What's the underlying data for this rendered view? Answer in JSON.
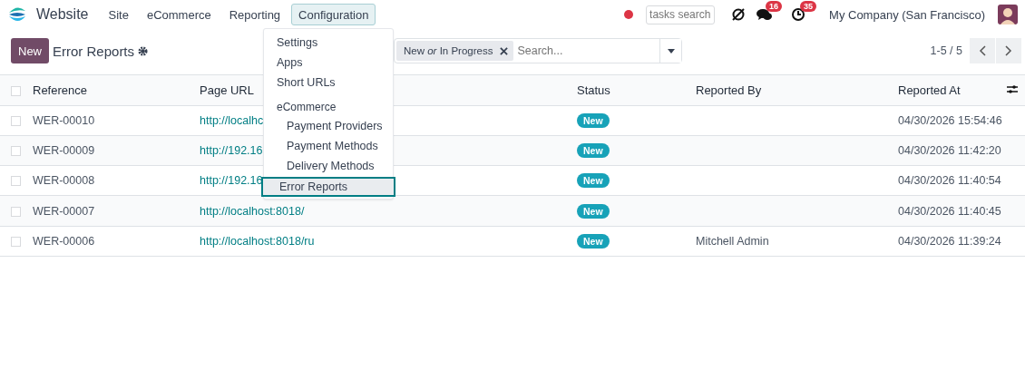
{
  "navbar": {
    "brand": "Website",
    "menus": [
      {
        "label": "Site",
        "selected": false
      },
      {
        "label": "eCommerce",
        "selected": false
      },
      {
        "label": "Reporting",
        "selected": false
      },
      {
        "label": "Configuration",
        "selected": true
      }
    ],
    "tasks_search": {
      "placeholder": "tasks search"
    },
    "messages_count": "16",
    "activities_count": "35",
    "company": "My Company (San Francisco)"
  },
  "dropdown": [
    {
      "kind": "item",
      "label": "Settings",
      "selected": false
    },
    {
      "kind": "item",
      "label": "Apps",
      "selected": false
    },
    {
      "kind": "item",
      "label": "Short URLs",
      "selected": false
    },
    {
      "kind": "header",
      "label": "eCommerce",
      "selected": false
    },
    {
      "kind": "subitem",
      "label": "Payment Providers",
      "selected": false
    },
    {
      "kind": "subitem",
      "label": "Payment Methods",
      "selected": false
    },
    {
      "kind": "subitem",
      "label": "Delivery Methods",
      "selected": false
    },
    {
      "kind": "item",
      "label": "Error Reports",
      "selected": true
    }
  ],
  "control_panel": {
    "new_button": "New",
    "title": "Error Reports",
    "facet": "New *or* In Progress",
    "search": {
      "placeholder": "Search..."
    },
    "pager": "1-5 / 5"
  },
  "table": {
    "select_all_checked": false,
    "columns": [
      "Reference",
      "Page URL",
      "Status",
      "Reported By",
      "Reported At"
    ],
    "rows": [
      {
        "reference": "WER-00010",
        "page_url": "http://localhc",
        "status": "New",
        "reported_by": "",
        "reported_at": "04/30/2026 15:54:46",
        "checked": false
      },
      {
        "reference": "WER-00009",
        "page_url": "http://192.16",
        "status": "New",
        "reported_by": "",
        "reported_at": "04/30/2026 11:42:20",
        "checked": false
      },
      {
        "reference": "WER-00008",
        "page_url": "http://192.16",
        "status": "New",
        "reported_by": "",
        "reported_at": "04/30/2026 11:40:54",
        "checked": false
      },
      {
        "reference": "WER-00007",
        "page_url": "http://localhost:8018/",
        "status": "New",
        "reported_by": "",
        "reported_at": "04/30/2026 11:40:45",
        "checked": false
      },
      {
        "reference": "WER-00006",
        "page_url": "http://localhost:8018/ru",
        "status": "New",
        "reported_by": "Mitchell Admin",
        "reported_at": "04/30/2026 11:39:24",
        "checked": false
      }
    ]
  }
}
